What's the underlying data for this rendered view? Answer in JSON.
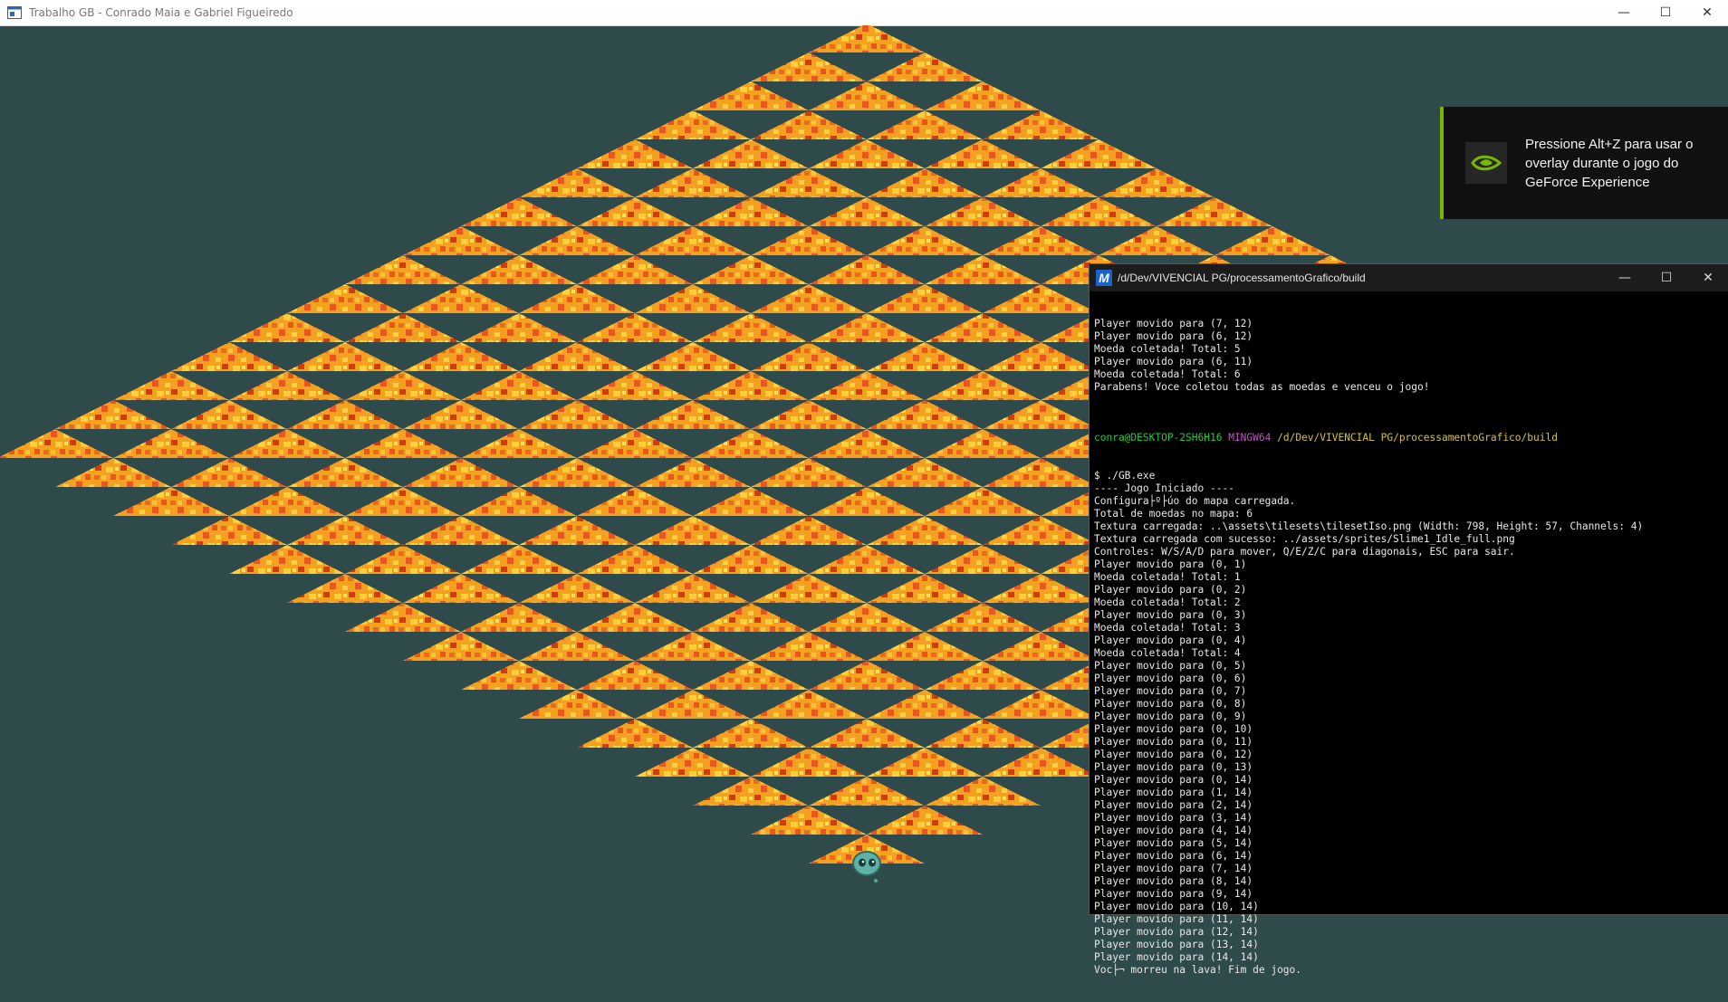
{
  "window": {
    "title": "Trabalho GB - Conrado Maia e Gabriel Figueiredo",
    "controls": [
      "—",
      "☐",
      "✕"
    ]
  },
  "game": {
    "grid_size": 15,
    "background_color": "#2f4a4a",
    "tile_texture": "lava",
    "lava_colors": [
      "#f5a623",
      "#e8581c",
      "#ffd23f",
      "#d23a12"
    ],
    "player": {
      "sprite": "slime-icon",
      "tile": [
        14,
        14
      ]
    }
  },
  "overlay": {
    "message": "Pressione Alt+Z para usar o overlay durante o jogo do GeForce Experience",
    "accent_color": "#76b900",
    "icon": "nvidia-icon"
  },
  "terminal": {
    "title": "/d/Dev/VIVENCIAL PG/processamentoGrafico/build",
    "icon": "mingw-icon",
    "controls": [
      "—",
      "☐",
      "✕"
    ],
    "prompt": {
      "user": "conra@DESKTOP-2SH6H16",
      "host": "MINGW64",
      "path": "/d/Dev/VIVENCIAL PG/processamentoGrafico/build"
    },
    "lines_before": [
      "Player movido para (7, 12)",
      "Player movido para (6, 12)",
      "Moeda coletada! Total: 5",
      "Player movido para (6, 11)",
      "Moeda coletada! Total: 6",
      "Parabens! Voce coletou todas as moedas e venceu o jogo!",
      ""
    ],
    "lines_after": [
      "$ ./GB.exe",
      "---- Jogo Iniciado ----",
      "Configura├º├úo do mapa carregada.",
      "Total de moedas no mapa: 6",
      "Textura carregada: ..\\assets\\tilesets\\tilesetIso.png (Width: 798, Height: 57, Channels: 4)",
      "Textura carregada com sucesso: ../assets/sprites/Slime1_Idle_full.png",
      "Controles: W/S/A/D para mover, Q/E/Z/C para diagonais, ESC para sair.",
      "Player movido para (0, 1)",
      "Moeda coletada! Total: 1",
      "Player movido para (0, 2)",
      "Moeda coletada! Total: 2",
      "Player movido para (0, 3)",
      "Moeda coletada! Total: 3",
      "Player movido para (0, 4)",
      "Moeda coletada! Total: 4",
      "Player movido para (0, 5)",
      "Player movido para (0, 6)",
      "Player movido para (0, 7)",
      "Player movido para (0, 8)",
      "Player movido para (0, 9)",
      "Player movido para (0, 10)",
      "Player movido para (0, 11)",
      "Player movido para (0, 12)",
      "Player movido para (0, 13)",
      "Player movido para (0, 14)",
      "Player movido para (1, 14)",
      "Player movido para (2, 14)",
      "Player movido para (3, 14)",
      "Player movido para (4, 14)",
      "Player movido para (5, 14)",
      "Player movido para (6, 14)",
      "Player movido para (7, 14)",
      "Player movido para (8, 14)",
      "Player movido para (9, 14)",
      "Player movido para (10, 14)",
      "Player movido para (11, 14)",
      "Player movido para (12, 14)",
      "Player movido para (13, 14)",
      "Player movido para (14, 14)",
      "Voc├¬ morreu na lava! Fim de jogo."
    ]
  }
}
